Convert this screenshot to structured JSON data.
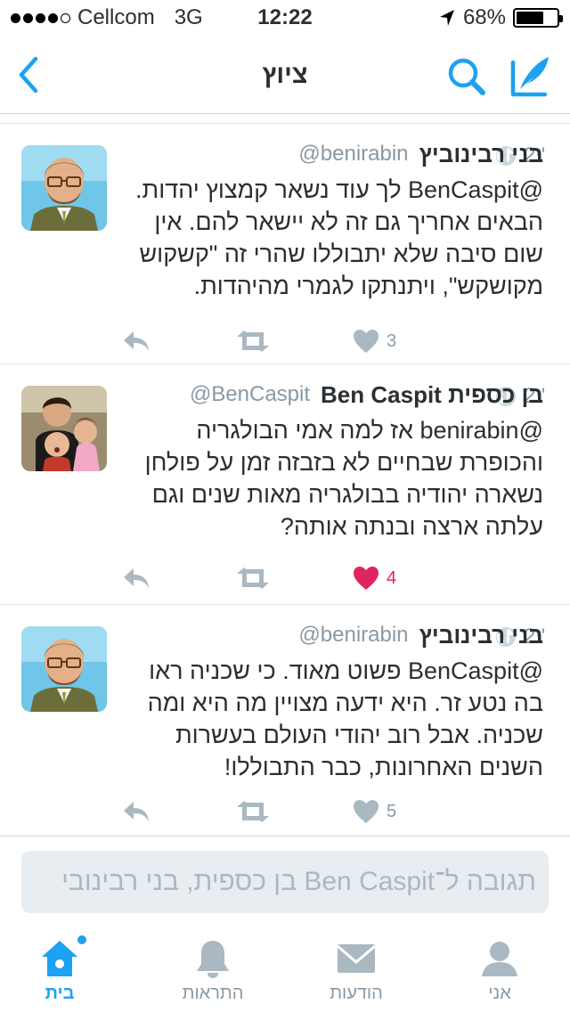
{
  "status_bar": {
    "carrier": "Cellcom",
    "network": "3G",
    "time": "12:22",
    "battery": "68%",
    "battery_level": 0.68
  },
  "nav": {
    "title": "ציוץ"
  },
  "tweets": [
    {
      "display_name": "בני רבינוביץ",
      "handle": "@benirabin",
      "timestamp": "2י'",
      "text": "@BenCaspit לך עוד נשאר קמצוץ יהדות. הבאים אחריך גם זה לא יישאר להם. אין שום סיבה שלא יתבוללו שהרי זה \"קשקוש מקושקש\", ויתנתקו לגמרי מהיהדות.",
      "likes": "3",
      "liked": false
    },
    {
      "display_name": "בן כספית Ben Caspit",
      "handle": "@BenCaspit",
      "timestamp": "2י'",
      "text": "@benirabin אז למה אמי הבולגריה והכופרת שבחיים לא בזבזה זמן על פולחן נשארה יהודיה בבולגריה מאות שנים וגם עלתה ארצה ובנתה אותה?",
      "likes": "4",
      "liked": true
    },
    {
      "display_name": "בני רבינוביץ",
      "handle": "@benirabin",
      "timestamp": "2י'",
      "text": "@BenCaspit פשוט מאוד. כי שכניה ראו בה נטע זר. היא ידעה מצויין מה היא ומה שכניה. אבל רוב יהודי העולם בעשרות השנים האחרונות, כבר התבוללו!",
      "likes": "5",
      "liked": false
    }
  ],
  "reply": {
    "placeholder": "תגובה ל־Ben Caspit בן כספית, בני רבינובי"
  },
  "tabs": [
    {
      "label": "בית",
      "icon": "home-icon",
      "active": true
    },
    {
      "label": "התראות",
      "icon": "bell-icon",
      "active": false
    },
    {
      "label": "הודעות",
      "icon": "envelope-icon",
      "active": false
    },
    {
      "label": "אני",
      "icon": "person-icon",
      "active": false
    }
  ],
  "colors": {
    "accent": "#1da1f2",
    "like_active": "#e0245e",
    "muted": "#8899a6",
    "icon_gray": "#aab8c2"
  }
}
